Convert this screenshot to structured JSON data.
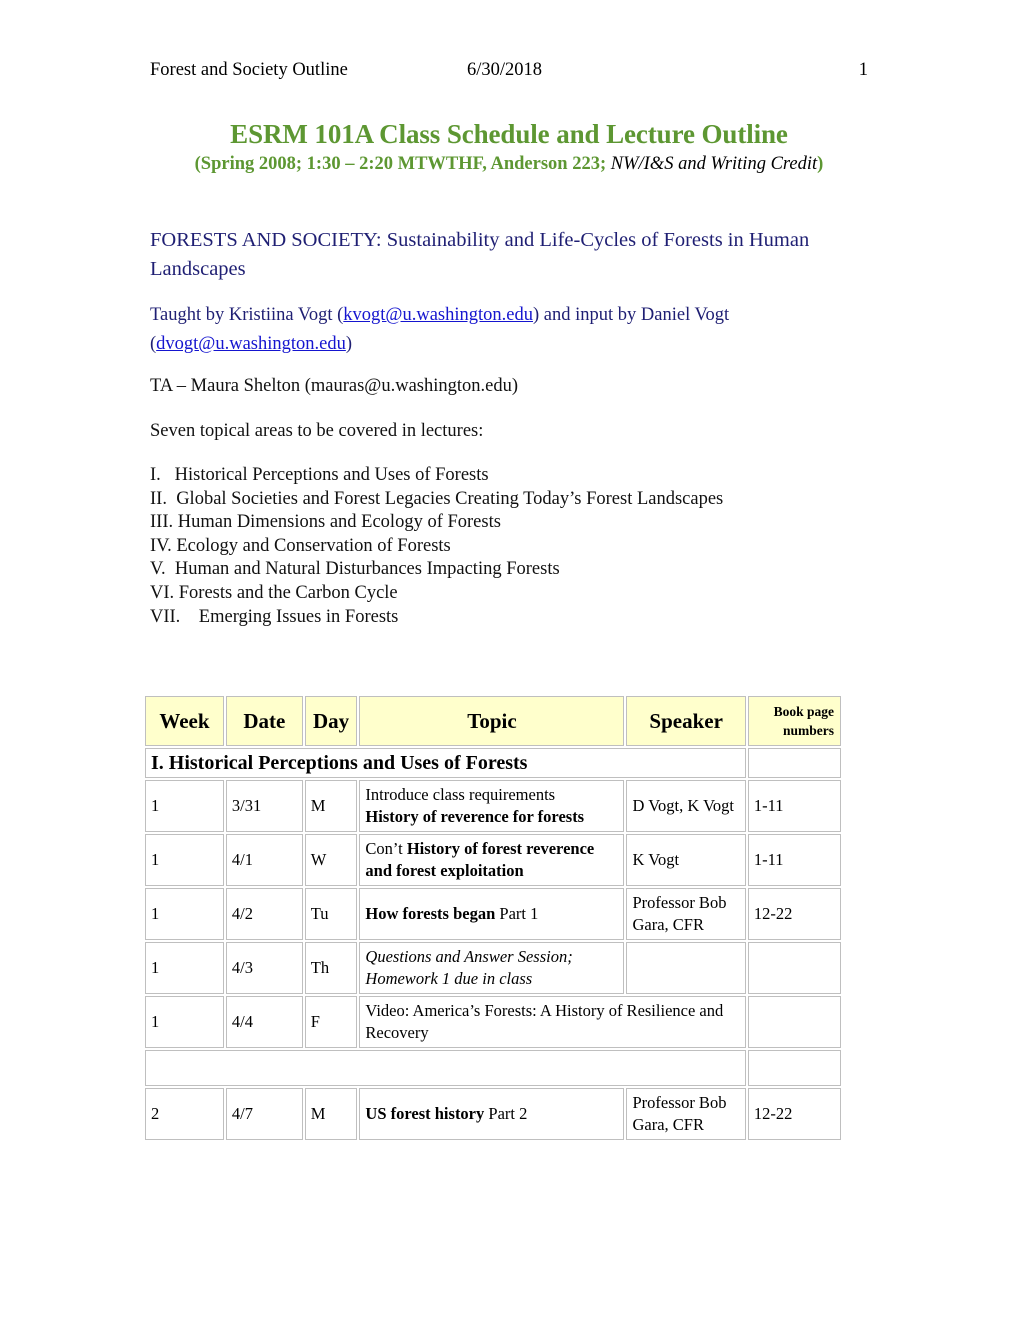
{
  "header": {
    "title": "Forest and Society Outline",
    "date": "6/30/2018",
    "page_number": "1"
  },
  "title_block": {
    "main_title": "ESRM 101A Class Schedule and Lecture Outline",
    "subtitle_prefix": "(Spring 2008; 1:30 – 2:20 MTWTHF, Anderson 223; ",
    "subtitle_italic": "NW/I&S and Writing Credit",
    "subtitle_suffix": ")"
  },
  "course": {
    "heading": "FORESTS AND SOCIETY: Sustainability and Life-Cycles of Forests in Human Landscapes",
    "taught_prefix": "Taught by Kristiina Vogt (",
    "instructor_email_1": "kvogt@u.washington.edu",
    "taught_middle": ") and input by Daniel Vogt (",
    "instructor_email_2": "dvogt@u.washington.edu",
    "taught_suffix": ")",
    "ta_line": "TA – Maura Shelton (mauras@u.washington.edu)",
    "topical_intro": "Seven topical areas to be covered in lectures:"
  },
  "topical_areas": [
    "I.   Historical Perceptions and Uses of Forests",
    "II.  Global Societies and Forest Legacies Creating Today’s Forest Landscapes",
    "III. Human Dimensions and Ecology of Forests",
    "IV. Ecology and Conservation of Forests",
    "V.  Human and Natural Disturbances Impacting Forests",
    "VI. Forests and the Carbon Cycle",
    "VII.    Emerging Issues in Forests"
  ],
  "schedule": {
    "columns": [
      "Week",
      "Date",
      "Day",
      "Topic",
      "Speaker",
      "Book page numbers"
    ],
    "section_title": "I. Historical Perceptions and Uses of Forests",
    "rows": [
      {
        "week": "1",
        "date": "3/31",
        "day": "M",
        "topic_regular": "Introduce class requirements",
        "topic_bold": "History of reverence for forests",
        "speaker": "D Vogt, K Vogt",
        "pages": "1-11"
      },
      {
        "week": "1",
        "date": "4/1",
        "day": "W",
        "topic_regular": "Con’t ",
        "topic_bold": "History of forest reverence and forest exploitation",
        "speaker": "K Vogt",
        "pages": "1-11"
      },
      {
        "week": "1",
        "date": "4/2",
        "day": "Tu",
        "topic_bold": "How forests began",
        "topic_regular": " Part 1",
        "speaker": "Professor Bob Gara, CFR",
        "pages": "12-22"
      },
      {
        "week": "1",
        "date": "4/3",
        "day": "Th",
        "topic_italic": "Questions and Answer Session; Homework 1 due in class",
        "speaker": "",
        "pages": ""
      },
      {
        "week": "1",
        "date": "4/4",
        "day": "F",
        "topic_regular": "Video: America’s Forests: A History of Resilience and Recovery",
        "speaker": "",
        "pages": ""
      },
      {
        "week": "2",
        "date": "4/7",
        "day": "M",
        "topic_bold": "US forest history",
        "topic_regular": " Part 2",
        "speaker": "Professor Bob Gara, CFR",
        "pages": "12-22"
      }
    ]
  }
}
